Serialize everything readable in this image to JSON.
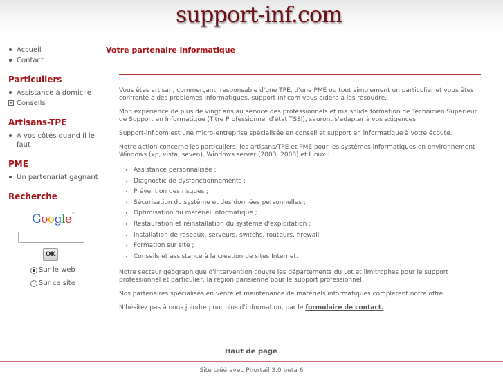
{
  "header": {
    "logo_text": "support-inf.com"
  },
  "sidebar": {
    "nav": [
      {
        "label": "Accueil"
      },
      {
        "label": "Contact"
      }
    ],
    "sections": [
      {
        "title": "Particuliers",
        "items": [
          {
            "label": "Assistance à domicile",
            "marker": "dot"
          },
          {
            "label": "Conseils",
            "marker": "plus"
          }
        ]
      },
      {
        "title": "Artisans-TPE",
        "items": [
          {
            "label": "A vos côtés quand il le faut",
            "marker": "dot"
          }
        ]
      },
      {
        "title": "PME",
        "items": [
          {
            "label": "Un partenariat gagnant",
            "marker": "dot"
          }
        ]
      }
    ],
    "search": {
      "title": "Recherche",
      "logo_letters": [
        "G",
        "o",
        "o",
        "g",
        "l",
        "e"
      ],
      "logo_mark": "™",
      "input_value": "",
      "ok_label": "OK",
      "option_web": "Sur le web",
      "option_site": "Sur ce site",
      "selected": "web"
    }
  },
  "main": {
    "title": "Votre partenaire informatique",
    "p1": "Vous êtes artisan, commerçant, responsable d'une TPE, d'une PME ou tout simplement un particulier et vous êtes confronté à des problèmes informatiques, support-inf.com vous aidera à les résoudre.",
    "p2": "Mon expérience de plus de vingt ans au service des professionnels et ma solide formation de Technicien Supérieur de Support en Informatique (Titre Professionnel d'état TSSI), sauront s'adapter à vos exigences.",
    "p3": "Support-inf.com est une micro-entreprise spécialisée en conseil et support en informatique à votre écoute.",
    "p4": "Notre action concerne les particuliers, les artisans/TPE et PME pour les systèmes informatiques en environnement Windows (xp, vista, seven), Windows server (2003, 2008) et Linux :",
    "services": [
      "Assistance personnalisée ;",
      "Diagnostic de dysfonctionnements ;",
      "Prévention des risques ;",
      "Sécurisation du système et des données personnelles ;",
      "Optimisation du matériel informatique ;",
      "Restauration et réinstallation du système d'exploitation ;",
      "Installation de réseaux, serveurs, switchs, routeurs, firewall ;",
      "Formation sur site ;",
      "Conseils et assistance à la création de sites Internet."
    ],
    "p5": "Notre secteur géographique d'intervention couvre les départements du Lot et limitrophes pour le support professionnel et particulier, la région parisienne pour le support professionnel.",
    "p6": "Nos partenaires spécialisés en vente et maintenance de matériels informatiques complètent notre offre.",
    "p7_prefix": "N'hésitez pas à nous joindre pour plus d'information, par le ",
    "p7_link": "formulaire de contact."
  },
  "top_link": "Haut de page",
  "footer": "Site créé avec Phortail 3.0 beta 6"
}
